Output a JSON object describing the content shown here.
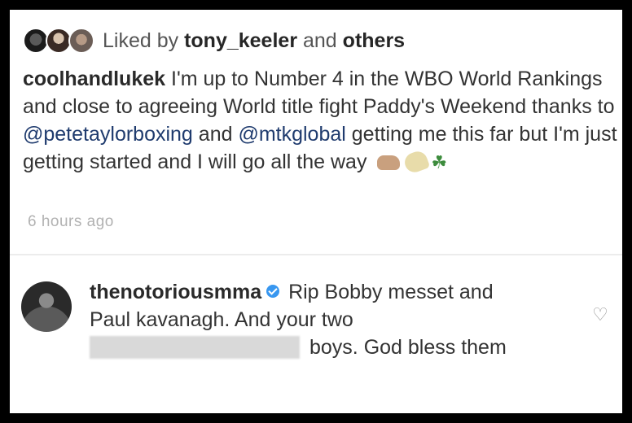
{
  "likes": {
    "prefix": "Liked by",
    "user": "tony_keeler",
    "conjunction": "and",
    "others": "others"
  },
  "post": {
    "username": "coolhandlukek",
    "caption_part1": " I'm up to Number 4 in the WBO World Rankings and close to agreeing World title fight Paddy's Weekend thanks to ",
    "mention1": "@petetaylorboxing",
    "caption_part2": " and ",
    "mention2": "@mtkglobal",
    "caption_part3": " getting me this far but I'm just getting started and I will go all the way",
    "emojis": [
      "fist-emoji",
      "flexed-arm-emoji",
      "shamrock-emoji"
    ],
    "timestamp": "6 hours ago"
  },
  "comment": {
    "username": "thenotoriousmma",
    "verified": true,
    "text_part1": "Rip Bobby messet and Paul kavanagh. And your two",
    "text_part2": "boys. God bless them"
  },
  "colors": {
    "verified_badge": "#3897f0",
    "timestamp": "#b2b2b2",
    "mention": "#1f3b6e"
  }
}
